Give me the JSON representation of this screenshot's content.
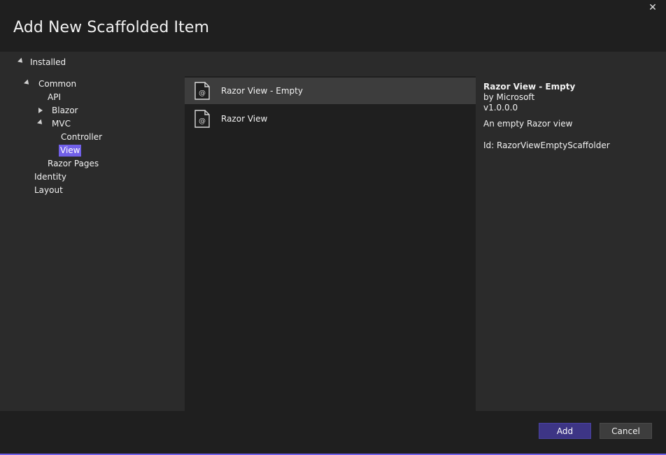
{
  "dialog": {
    "title": "Add New Scaffolded Item",
    "close_glyph": "✕"
  },
  "tree": {
    "root_label": "Installed",
    "items": [
      {
        "label": "Common"
      },
      {
        "label": "API"
      },
      {
        "label": "Blazor"
      },
      {
        "label": "MVC"
      },
      {
        "label": "Controller"
      },
      {
        "label": "View"
      },
      {
        "label": "Razor Pages"
      },
      {
        "label": "Identity"
      },
      {
        "label": "Layout"
      }
    ]
  },
  "templates": [
    {
      "label": "Razor View - Empty",
      "icon": "razor-file-icon"
    },
    {
      "label": "Razor View",
      "icon": "razor-file-icon"
    }
  ],
  "details": {
    "name": "Razor View - Empty",
    "author": "by Microsoft",
    "version": "v1.0.0.0",
    "description": "An empty Razor view",
    "id": "Id: RazorViewEmptyScaffolder"
  },
  "buttons": {
    "add": "Add",
    "cancel": "Cancel"
  },
  "colors": {
    "accent": "#7160e8",
    "primary_button": "#3d3585",
    "background": "#1f1f1f",
    "panel": "#2b2b2b"
  }
}
